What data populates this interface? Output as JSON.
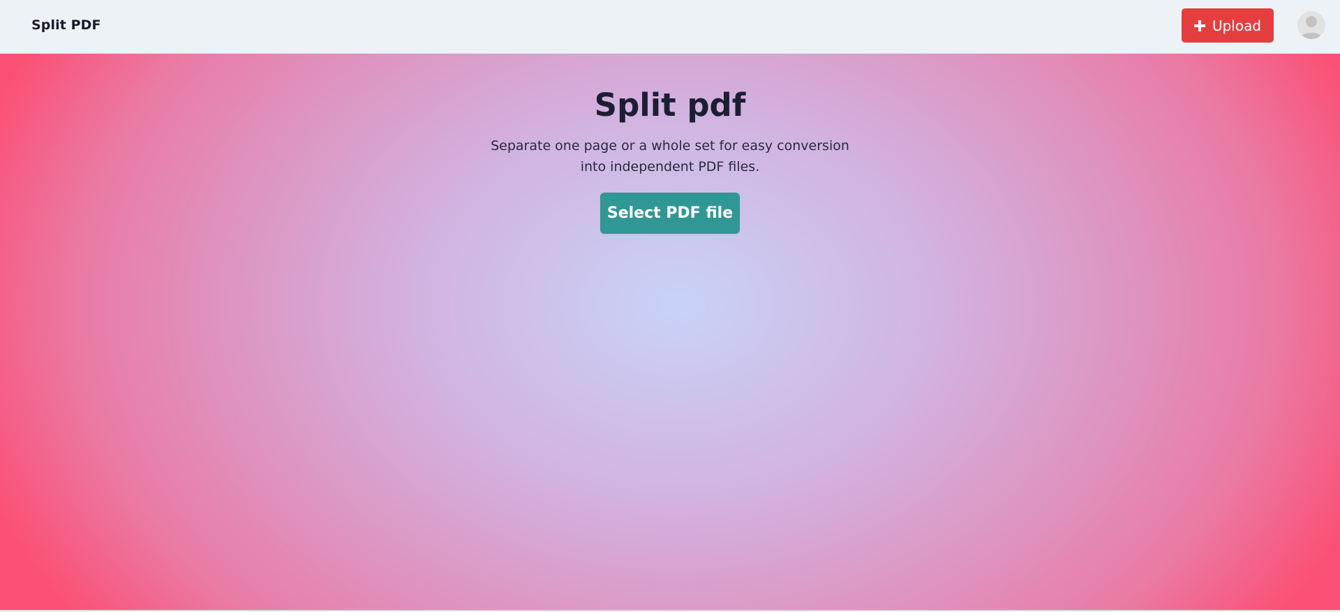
{
  "header": {
    "brand": "Split PDF",
    "upload_label": "Upload",
    "upload_icon": "plus-icon",
    "avatar_icon": "user-avatar-icon"
  },
  "hero": {
    "title": "Split pdf",
    "subtitle": "Separate one page or a whole set for easy conversion into independent PDF files.",
    "select_label": "Select PDF file"
  },
  "colors": {
    "upload_button": "#e53e3e",
    "select_button": "#319795",
    "header_bg": "#edf2f7",
    "gradient_center": "#c8d3f7",
    "gradient_edge": "#fb5076"
  }
}
